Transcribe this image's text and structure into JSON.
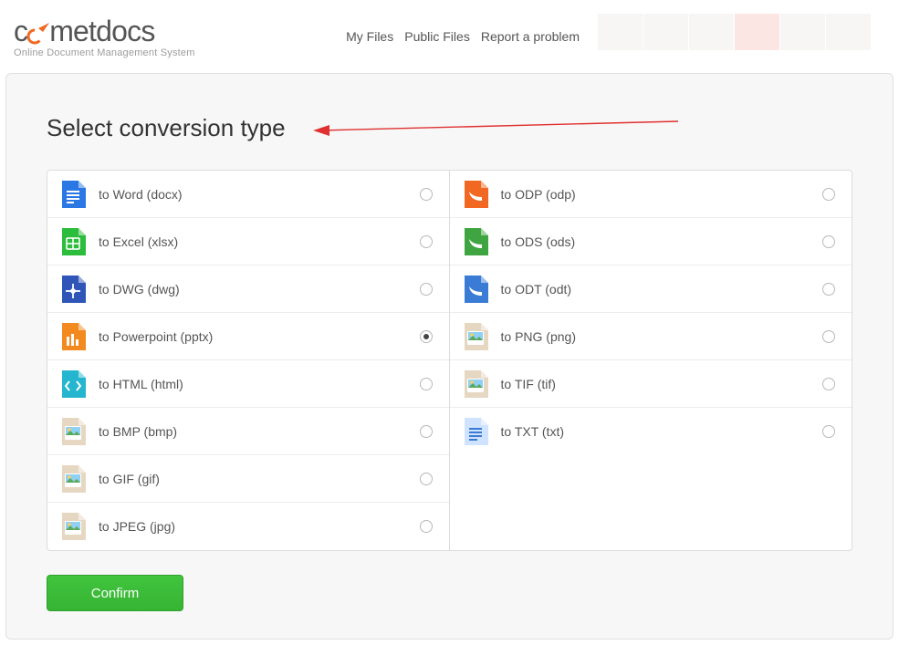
{
  "logo": {
    "word": "cometdocs",
    "tagline": "Online Document Management System"
  },
  "nav": {
    "items": [
      "My Files",
      "Public Files",
      "Report a problem"
    ]
  },
  "panel": {
    "title": "Select conversion type",
    "confirm": "Confirm"
  },
  "options": {
    "left": [
      {
        "id": "to-word",
        "label": "to Word (docx)",
        "icon": "word",
        "color": "#2b78e4",
        "selected": false
      },
      {
        "id": "to-excel",
        "label": "to Excel (xlsx)",
        "icon": "excel",
        "color": "#2bbd3b",
        "selected": false
      },
      {
        "id": "to-dwg",
        "label": "to DWG (dwg)",
        "icon": "dwg",
        "color": "#2f55b8",
        "selected": false
      },
      {
        "id": "to-ppt",
        "label": "to Powerpoint (pptx)",
        "icon": "ppt",
        "color": "#f28a1f",
        "selected": true
      },
      {
        "id": "to-html",
        "label": "to HTML (html)",
        "icon": "html",
        "color": "#24b6cf",
        "selected": false
      },
      {
        "id": "to-bmp",
        "label": "to BMP (bmp)",
        "icon": "img",
        "color": "#e6d7c3",
        "selected": false
      },
      {
        "id": "to-gif",
        "label": "to GIF (gif)",
        "icon": "img",
        "color": "#e6d7c3",
        "selected": false
      },
      {
        "id": "to-jpeg",
        "label": "to JPEG (jpg)",
        "icon": "img",
        "color": "#e6d7c3",
        "selected": false
      }
    ],
    "right": [
      {
        "id": "to-odp",
        "label": "to ODP (odp)",
        "icon": "odp",
        "color": "#f26822",
        "selected": false
      },
      {
        "id": "to-ods",
        "label": "to ODS (ods)",
        "icon": "odp",
        "color": "#3fa540",
        "selected": false
      },
      {
        "id": "to-odt",
        "label": "to ODT (odt)",
        "icon": "odp",
        "color": "#3a7bd5",
        "selected": false
      },
      {
        "id": "to-png",
        "label": "to PNG (png)",
        "icon": "img",
        "color": "#e6d7c3",
        "selected": false
      },
      {
        "id": "to-tif",
        "label": "to TIF (tif)",
        "icon": "img",
        "color": "#e6d7c3",
        "selected": false
      },
      {
        "id": "to-txt",
        "label": "to TXT (txt)",
        "icon": "txt",
        "color": "#cfe3ff",
        "selected": false
      }
    ]
  }
}
